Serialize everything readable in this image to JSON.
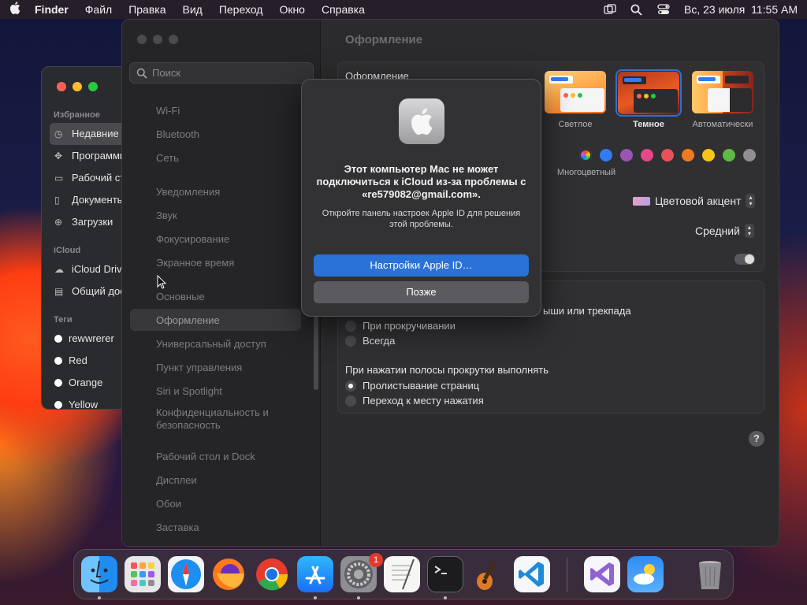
{
  "menubar": {
    "app": "Finder",
    "items": [
      "Файл",
      "Правка",
      "Вид",
      "Переход",
      "Окно",
      "Справка"
    ],
    "clock": "Вс, 23 июля  11:55 AM",
    "icons": [
      "apple-logo-icon",
      "window-mirror-icon",
      "search-icon",
      "control-center-icon"
    ]
  },
  "finder": {
    "sections": {
      "favorites": "Избранное",
      "icloud": "iCloud",
      "tags": "Теги"
    },
    "favorites": [
      "Недавние",
      "Программы",
      "Рабочий стол",
      "Документы",
      "Загрузки"
    ],
    "icloud": [
      "iCloud Drive",
      "Общий доступ"
    ],
    "tags": [
      {
        "label": "rewwrerer",
        "color": "#ffffff"
      },
      {
        "label": "Red",
        "color": "#ffffff"
      },
      {
        "label": "Orange",
        "color": "#ffffff"
      },
      {
        "label": "Yellow",
        "color": "#ffffff"
      }
    ]
  },
  "settings": {
    "search_placeholder": "Поиск",
    "sidebar": [
      "Wi-Fi",
      "Bluetooth",
      "Сеть",
      "Уведомления",
      "Звук",
      "Фокусирование",
      "Экранное время",
      "Основные",
      "Оформление",
      "Универсальный доступ",
      "Пункт управления",
      "Siri и Spotlight",
      "Конфиденциальность и безопасность",
      "Рабочий стол и Dock",
      "Дисплеи",
      "Обои",
      "Заставка"
    ],
    "selected": "Оформление",
    "title": "Оформление",
    "appearance_label": "Оформление",
    "appearance_options": [
      "Светлое",
      "Темное",
      "Автоматически"
    ],
    "selected_appearance": "Темное",
    "accent_caption": "Многоцветный",
    "accent_colors": [
      "#2f7cf6",
      "#9a55b5",
      "#e8468b",
      "#e9505a",
      "#f07a22",
      "#f5c518",
      "#5fb946",
      "#8e8e93"
    ],
    "highlight_value": "Цветовой акцент",
    "sidebar_icon_size": "Средний",
    "scroll_label_partial": "ыши или трекпада",
    "scroll_options": [
      "При прокручивании",
      "Всегда"
    ],
    "click_label": "При нажатии полосы прокрутки выполнять",
    "click_options": [
      "Пролистывание страниц",
      "Переход к месту нажатия"
    ],
    "help": "?"
  },
  "dialog": {
    "title": "Этот компьютер Mac не может подключиться к iCloud из-за проблемы с «re579082@gmail.com».",
    "message": "Откройте панель настроек Apple ID для решения этой проблемы.",
    "primary_button": "Настройки Apple ID…",
    "secondary_button": "Позже"
  },
  "dock": {
    "apps": [
      "Finder",
      "Launchpad",
      "Safari",
      "Firefox",
      "Chrome",
      "App Store",
      "System Settings",
      "TextEdit",
      "Terminal",
      "GarageBand",
      "VS Code",
      "Visual Studio",
      "Weather",
      "Trash"
    ],
    "settings_badge": "1"
  }
}
